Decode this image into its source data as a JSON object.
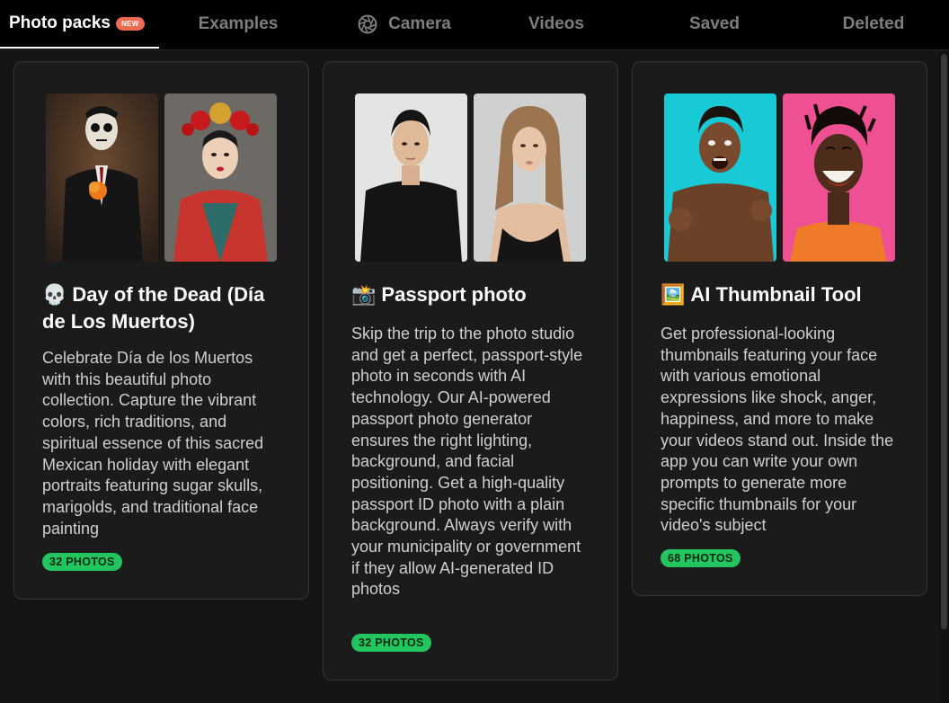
{
  "nav": {
    "tabs": [
      {
        "label": "Photo packs",
        "badge": "NEW"
      },
      {
        "label": "Examples"
      },
      {
        "label": "Camera",
        "icon": "camera-aperture-icon"
      },
      {
        "label": "Videos"
      },
      {
        "label": "Saved"
      },
      {
        "label": "Deleted"
      }
    ]
  },
  "cards": [
    {
      "emoji": "💀",
      "title": "Day of the Dead (Día de Los Muertos)",
      "description": "Celebrate Día de los Muertos with this beautiful photo collection. Capture the vibrant colors, rich traditions, and spiritual essence of this sacred Mexican holiday with elegant portraits featuring sugar skulls, marigolds, and traditional face painting",
      "count": "32 PHOTOS"
    },
    {
      "emoji": "📸",
      "title": "Passport photo",
      "description": "Skip the trip to the photo studio and get a perfect, passport-style photo in seconds with AI technology. Our AI-powered passport photo generator ensures the right lighting, background, and facial positioning. Get a high-quality passport ID photo with a plain background. Always verify with your municipality or government if they allow AI-generated ID photos",
      "count": "32 PHOTOS"
    },
    {
      "emoji": "🖼️",
      "title": "AI Thumbnail Tool",
      "description": "Get professional-looking thumbnails featuring your face with various emotional expressions like shock, anger, happiness, and more to make your videos stand out. Inside the app you can write your own prompts to generate more specific thumbnails for your video's subject",
      "count": "68 PHOTOS"
    }
  ],
  "colors": {
    "background": "#151515",
    "card": "#1b1b1b",
    "accent_new": "#ef6a50",
    "photo_count_pill": "#22c55e"
  }
}
